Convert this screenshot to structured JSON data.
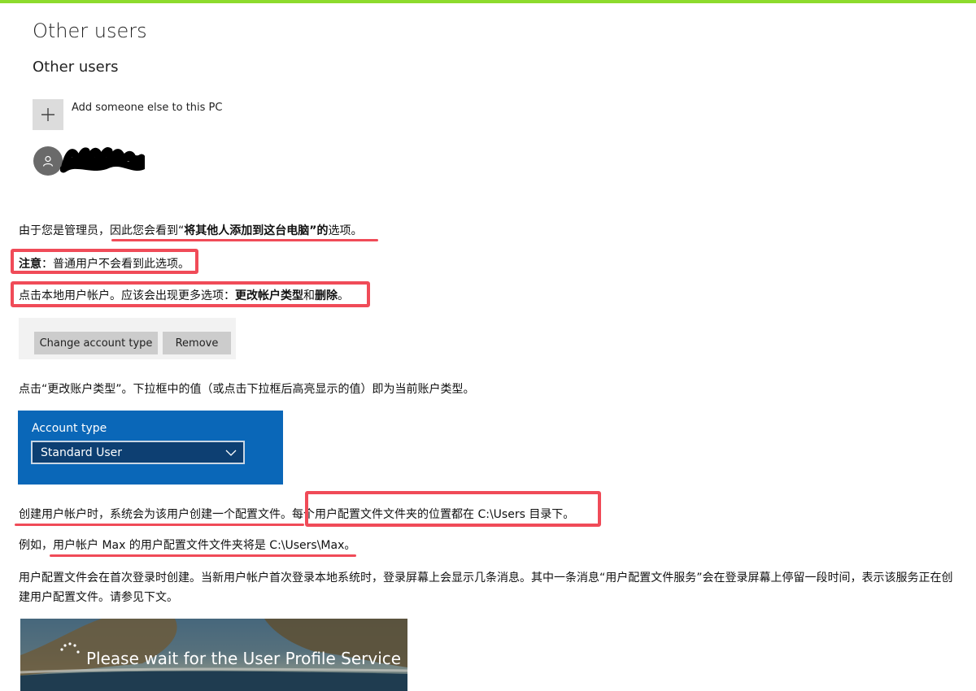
{
  "header": {
    "title": "Other users",
    "section_title": "Other users"
  },
  "add_user": {
    "label": "Add someone else to this PC"
  },
  "paragraphs": {
    "p1_a": "由于您是管理员，",
    "p1_b": "因此您会看到“",
    "p1_c": "将其他人添加到这台电脑”的",
    "p1_d": "选项。",
    "p2_a": "注意",
    "p2_b": "：普通用户不会看到此选项。",
    "p3_a": "点击本地用户帐户。应该会出现更多选项：",
    "p3_b": "更改帐户类型",
    "p3_c": "和",
    "p3_d": "删除",
    "p3_e": "。",
    "p4": "点击“更改账户类型”。下拉框中的值（或点击下拉框后高亮显示的值）即为当前账户类型。",
    "p5_a": "创建用户帐户时，系统会为该用户创建一个配置文件。",
    "p5_b": "每个用户配置文件文件夹的位置都在 C:\\Users 目录下。",
    "p6_a": "例如，",
    "p6_b": "用户帐户 Max 的用户配置文件文件夹将是 C:\\Users\\Max。",
    "p7": "用户配置文件会在首次登录时创建。当新用户帐户首次登录本地系统时，登录屏幕上会显示几条消息。其中一条消息“用户配置文件服务”会在登录屏幕上停留一段时间，表示该服务正在创建用户配置文件。请参见下文。"
  },
  "buttons": {
    "change_account_type": "Change account type",
    "remove": "Remove"
  },
  "account_type": {
    "label": "Account type",
    "selected": "Standard User"
  },
  "login_screen": {
    "message": "Please wait for the User Profile Service"
  },
  "colors": {
    "highlight_red": "#f04b58",
    "accent_blue": "#0a67b8",
    "top_bar_green": "#8ddb2d"
  }
}
